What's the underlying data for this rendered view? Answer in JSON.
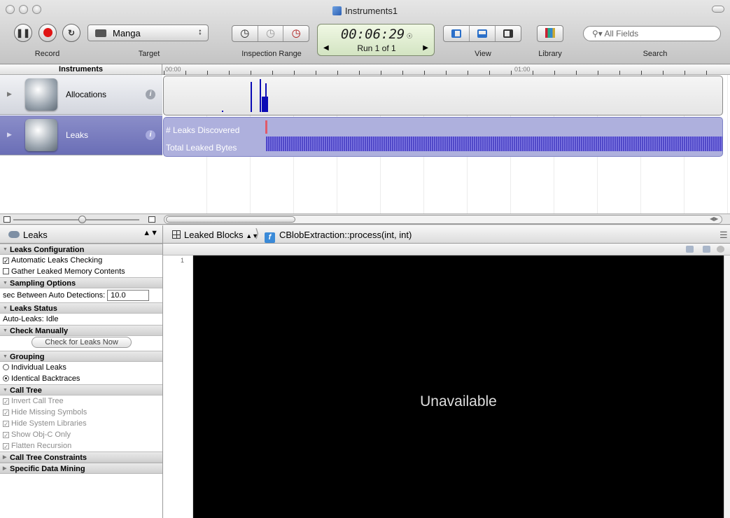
{
  "window": {
    "title": "Instruments1"
  },
  "toolbar": {
    "record_label": "Record",
    "target_label": "Target",
    "target_value": "Manga",
    "inspection_label": "Inspection Range",
    "time": "00:06:29",
    "run": "Run 1 of 1",
    "view_label": "View",
    "library_label": "Library",
    "search_label": "Search",
    "search_placeholder": "All Fields"
  },
  "ruler": {
    "header": "Instruments",
    "tick_start": "00:00",
    "tick_mid": "01:00"
  },
  "tracks": [
    {
      "name": "Allocations"
    },
    {
      "name": "Leaks",
      "series": [
        "# Leaks Discovered",
        "Total Leaked Bytes"
      ]
    }
  ],
  "detail": {
    "instrument": "Leaks",
    "crumb_view": "Leaked Blocks",
    "crumb_function": "CBlobExtraction::process(int, int)",
    "line_number": "1",
    "message": "Unavailable"
  },
  "sidebar": {
    "leaks_config": "Leaks Configuration",
    "auto_check": "Automatic Leaks Checking",
    "gather": "Gather Leaked Memory Contents",
    "sampling": "Sampling Options",
    "sec_between": "sec Between Auto Detections:",
    "sec_value": "10.0",
    "status_header": "Leaks Status",
    "status_value": "Auto-Leaks: Idle",
    "check_manually": "Check Manually",
    "check_now": "Check for Leaks Now",
    "grouping": "Grouping",
    "individual": "Individual Leaks",
    "identical": "Identical Backtraces",
    "call_tree": "Call Tree",
    "invert": "Invert Call Tree",
    "hide_missing": "Hide Missing Symbols",
    "hide_system": "Hide System Libraries",
    "show_objc": "Show Obj-C Only",
    "flatten": "Flatten Recursion",
    "constraints": "Call Tree Constraints",
    "data_mining": "Specific Data Mining"
  }
}
